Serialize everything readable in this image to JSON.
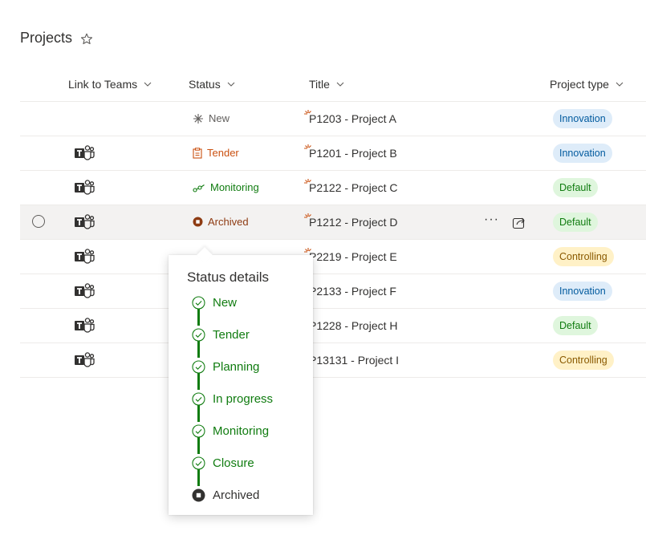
{
  "page": {
    "title": "Projects"
  },
  "columns": {
    "link_to_teams": "Link to Teams",
    "status": "Status",
    "title": "Title",
    "project_type": "Project type"
  },
  "rows": [
    {
      "teams": false,
      "status": "New",
      "status_key": "new",
      "title": "P1203 - Project A",
      "type": "Innovation",
      "type_key": "innovation"
    },
    {
      "teams": true,
      "status": "Tender",
      "status_key": "tender",
      "title": "P1201 - Project B",
      "type": "Innovation",
      "type_key": "innovation"
    },
    {
      "teams": true,
      "status": "Monitoring",
      "status_key": "monitoring",
      "title": "P2122 - Project C",
      "type": "Default",
      "type_key": "default"
    },
    {
      "teams": true,
      "status": "Archived",
      "status_key": "archived",
      "title": "P1212 - Project D",
      "type": "Default",
      "type_key": "default",
      "selected": true
    },
    {
      "teams": true,
      "status": "",
      "status_key": "hidden",
      "title": "P2219 - Project E",
      "type": "Controlling",
      "type_key": "controlling"
    },
    {
      "teams": true,
      "status": "",
      "status_key": "hidden",
      "title": "P2133 - Project F",
      "type": "Innovation",
      "type_key": "innovation"
    },
    {
      "teams": true,
      "status": "",
      "status_key": "hidden",
      "title": "P1228 - Project H",
      "type": "Default",
      "type_key": "default"
    },
    {
      "teams": true,
      "status": "",
      "status_key": "hidden",
      "title": "P13131 - Project I",
      "type": "Controlling",
      "type_key": "controlling"
    }
  ],
  "status_colors": {
    "new": "#605e5c",
    "tender": "#ca5010",
    "monitoring": "#107c10",
    "archived": "#8e3b12"
  },
  "type_colors": {
    "innovation": {
      "bg": "#deecf9",
      "fg": "#005a9e"
    },
    "default": {
      "bg": "#dff6dd",
      "fg": "#107c10"
    },
    "controlling": {
      "bg": "#fff1c7",
      "fg": "#8a5a00"
    }
  },
  "row_actions": {
    "more": "···"
  },
  "status_details": {
    "title": "Status details",
    "steps": [
      {
        "label": "New",
        "state": "done"
      },
      {
        "label": "Tender",
        "state": "done"
      },
      {
        "label": "Planning",
        "state": "done"
      },
      {
        "label": "In progress",
        "state": "done"
      },
      {
        "label": "Monitoring",
        "state": "done"
      },
      {
        "label": "Closure",
        "state": "done"
      },
      {
        "label": "Archived",
        "state": "current"
      }
    ],
    "done_color": "#107c10",
    "current_color": "#323130"
  },
  "icons": {
    "favorite": "star-outline-icon",
    "teams": "teams-icon",
    "more": "more-horizontal-icon",
    "share": "share-icon"
  }
}
